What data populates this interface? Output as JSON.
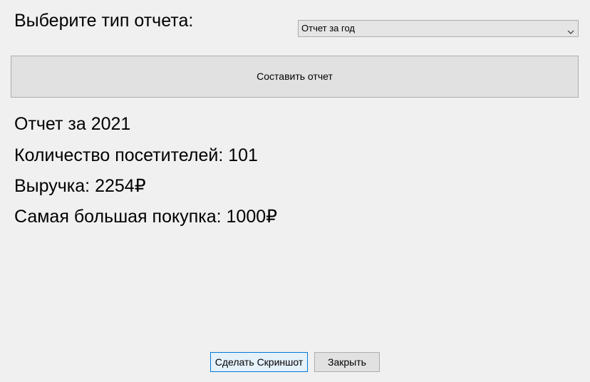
{
  "form": {
    "report_type_label": "Выберите тип отчета:",
    "report_type_selected": "Отчет за год",
    "make_report_label": "Составить отчет"
  },
  "report": {
    "title": "Отчет за 2021",
    "visitors": "Количество посетителей: 101",
    "revenue": "Выручка: 2254₽",
    "largest_purchase": "Самая большая покупка: 1000₽"
  },
  "footer": {
    "screenshot_label": "Сделать Скриншот",
    "close_label": "Закрыть"
  },
  "icons": {
    "select_arrow": "chevron-down-icon"
  }
}
